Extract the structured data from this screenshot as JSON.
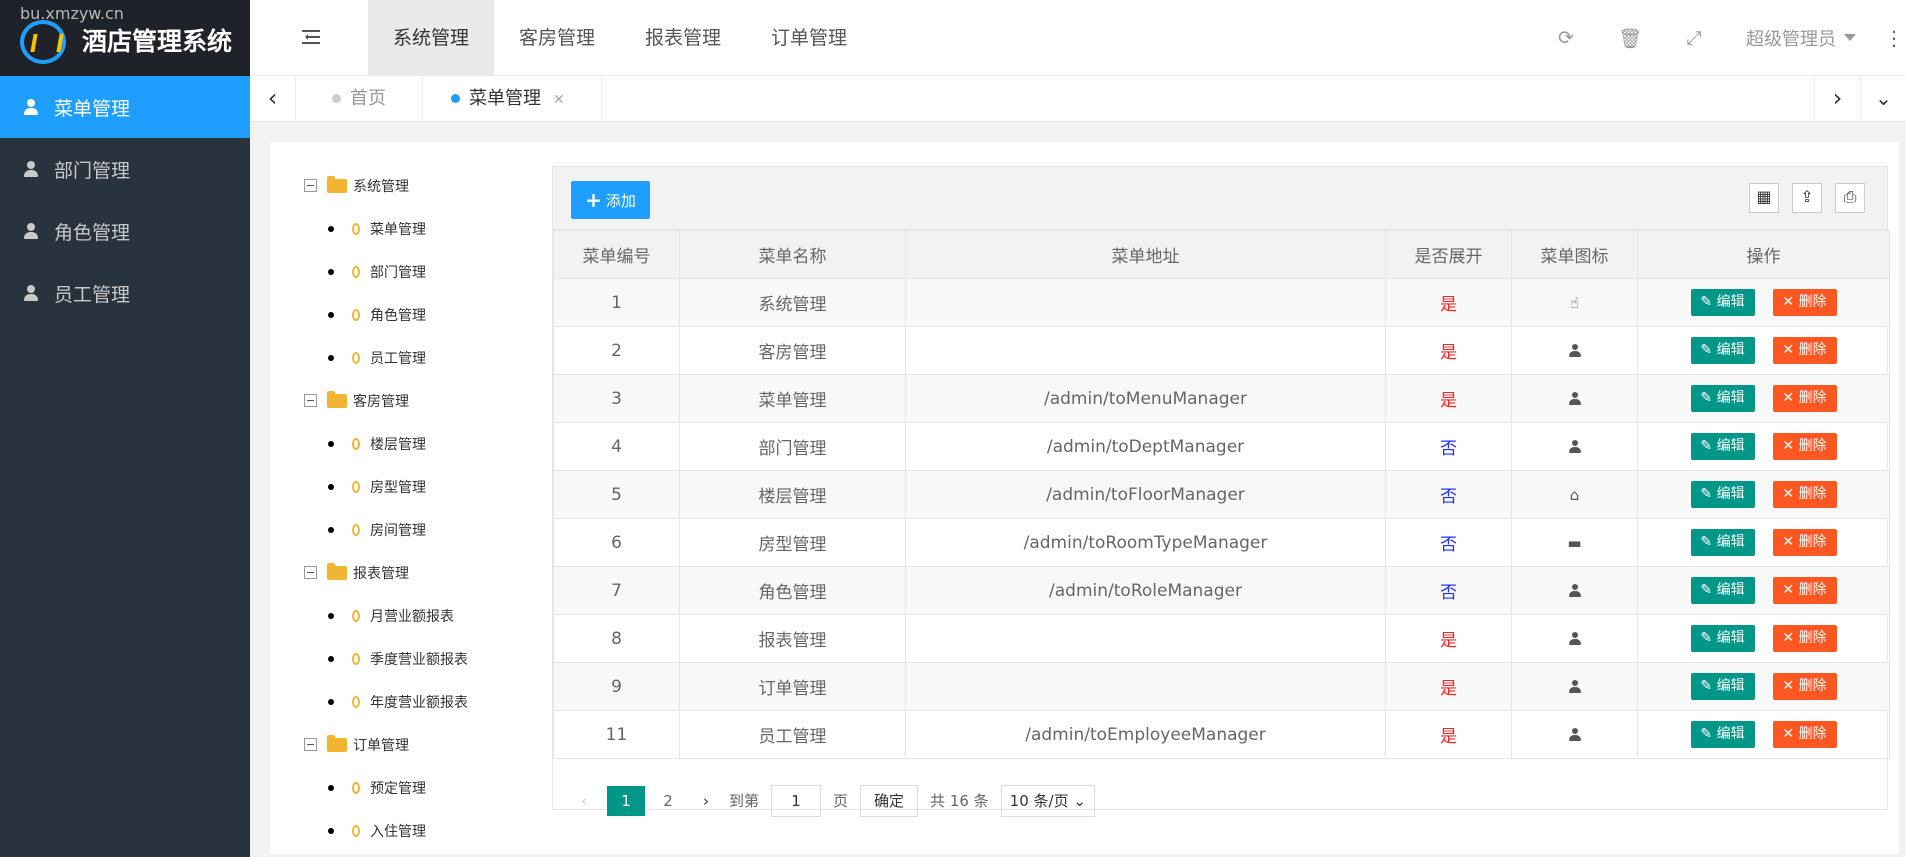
{
  "app": {
    "watermark": "bu.xmzyw.cn",
    "title": "酒店管理系统"
  },
  "sidebar": {
    "items": [
      {
        "label": "菜单管理",
        "active": true
      },
      {
        "label": "部门管理"
      },
      {
        "label": "角色管理"
      },
      {
        "label": "员工管理"
      }
    ]
  },
  "topnav": {
    "items": [
      "系统管理",
      "客房管理",
      "报表管理",
      "订单管理"
    ],
    "active": "系统管理",
    "user": "超级管理员"
  },
  "tabs": {
    "items": [
      {
        "label": "首页"
      },
      {
        "label": "菜单管理",
        "active": true
      }
    ]
  },
  "tree": {
    "groups": [
      {
        "label": "系统管理",
        "children": [
          "菜单管理",
          "部门管理",
          "角色管理",
          "员工管理"
        ]
      },
      {
        "label": "客房管理",
        "children": [
          "楼层管理",
          "房型管理",
          "房间管理"
        ]
      },
      {
        "label": "报表管理",
        "children": [
          "月营业额报表",
          "季度营业额报表",
          "年度营业额报表"
        ]
      },
      {
        "label": "订单管理",
        "children": [
          "预定管理",
          "入住管理"
        ]
      }
    ]
  },
  "toolbar": {
    "add_label": "添加"
  },
  "table": {
    "headers": [
      "菜单编号",
      "菜单名称",
      "菜单地址",
      "是否展开",
      "菜单图标",
      "操作"
    ],
    "edit_label": "编辑",
    "delete_label": "删除",
    "rows": [
      {
        "id": "1",
        "name": "系统管理",
        "url": "",
        "expand": "是",
        "icon": "hand-icon"
      },
      {
        "id": "2",
        "name": "客房管理",
        "url": "",
        "expand": "是",
        "icon": "user-icon"
      },
      {
        "id": "3",
        "name": "菜单管理",
        "url": "/admin/toMenuManager",
        "expand": "是",
        "icon": "user-icon"
      },
      {
        "id": "4",
        "name": "部门管理",
        "url": "/admin/toDeptManager",
        "expand": "否",
        "icon": "user-icon"
      },
      {
        "id": "5",
        "name": "楼层管理",
        "url": "/admin/toFloorManager",
        "expand": "否",
        "icon": "home-icon"
      },
      {
        "id": "6",
        "name": "房型管理",
        "url": "/admin/toRoomTypeManager",
        "expand": "否",
        "icon": "bed-icon"
      },
      {
        "id": "7",
        "name": "角色管理",
        "url": "/admin/toRoleManager",
        "expand": "否",
        "icon": "user-icon"
      },
      {
        "id": "8",
        "name": "报表管理",
        "url": "",
        "expand": "是",
        "icon": "user-icon"
      },
      {
        "id": "9",
        "name": "订单管理",
        "url": "",
        "expand": "是",
        "icon": "user-icon"
      },
      {
        "id": "11",
        "name": "员工管理",
        "url": "/admin/toEmployeeManager",
        "expand": "是",
        "icon": "user-icon"
      }
    ]
  },
  "pager": {
    "pages": [
      "1",
      "2"
    ],
    "current": "1",
    "goto_label": "到第",
    "page_value": "1",
    "page_unit": "页",
    "confirm_label": "确定",
    "total_label": "共 16 条",
    "per_page": "10 条/页"
  },
  "colors": {
    "accent": "#1e9fff",
    "sidebar": "#28333e",
    "edit": "#009688",
    "delete": "#ff5722"
  }
}
